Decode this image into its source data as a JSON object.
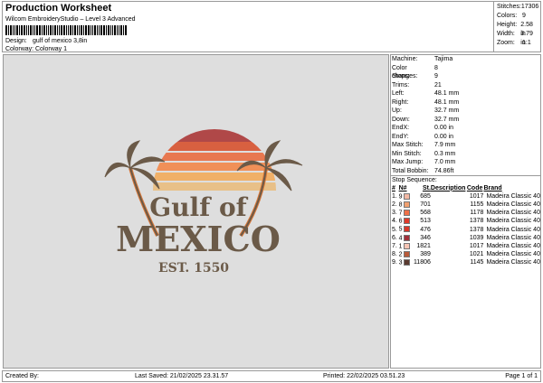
{
  "header": {
    "title": "Production Worksheet",
    "software": "Wilcom EmbroideryStudio – Level 3 Advanced",
    "design_label": "Design:",
    "design": "gulf of mexico 3,8in",
    "colorway_label": "Colorway:",
    "colorway": "Colorway 1"
  },
  "stats": [
    {
      "k": "Stitches:",
      "v": "17306"
    },
    {
      "k": "Colors:",
      "v": "9"
    },
    {
      "k": "Height:",
      "v": "2.58 in"
    },
    {
      "k": "Width:",
      "v": "3.79 in"
    },
    {
      "k": "Zoom:",
      "v": "1:1"
    }
  ],
  "artwork": {
    "line1": "Gulf of",
    "line2": "MEXICO",
    "line3": "EST. 1550"
  },
  "props": [
    {
      "k": "Machine:",
      "v": "Tajima"
    },
    {
      "k": "Color changes:",
      "v": "8"
    },
    {
      "k": "Stops:",
      "v": "9"
    },
    {
      "k": "Trims:",
      "v": "21"
    },
    {
      "k": "Left:",
      "v": "48.1 mm"
    },
    {
      "k": "Right:",
      "v": "48.1 mm"
    },
    {
      "k": "Up:",
      "v": "32.7 mm"
    },
    {
      "k": "Down:",
      "v": "32.7 mm"
    },
    {
      "k": "EndX:",
      "v": "0.00 in"
    },
    {
      "k": "EndY:",
      "v": "0.00 in"
    },
    {
      "k": "Max Stitch:",
      "v": "7.9 mm"
    },
    {
      "k": "Min Stitch:",
      "v": "0.3 mm"
    },
    {
      "k": "Max Jump:",
      "v": "7.0 mm"
    },
    {
      "k": "Total Bobbin:",
      "v": "74.86ft"
    }
  ],
  "sequence": {
    "title": "Stop Sequence:",
    "headers": [
      "#",
      "N#",
      "St.",
      "Description",
      "Code",
      "Brand"
    ],
    "rows": [
      {
        "n": "1.",
        "c": "9",
        "color": "#f2b8a4",
        "st": "685",
        "code": "1017",
        "brand": "Madeira Classic 40"
      },
      {
        "n": "2.",
        "c": "8",
        "color": "#f0a070",
        "st": "701",
        "code": "1155",
        "brand": "Madeira Classic 40"
      },
      {
        "n": "3.",
        "c": "7",
        "color": "#f07048",
        "st": "568",
        "code": "1178",
        "brand": "Madeira Classic 40"
      },
      {
        "n": "4.",
        "c": "6",
        "color": "#e03a2a",
        "st": "513",
        "code": "1378",
        "brand": "Madeira Classic 40"
      },
      {
        "n": "5.",
        "c": "5",
        "color": "#d8382a",
        "st": "476",
        "code": "1378",
        "brand": "Madeira Classic 40"
      },
      {
        "n": "6.",
        "c": "4",
        "color": "#a0303a",
        "st": "346",
        "code": "1039",
        "brand": "Madeira Classic 40"
      },
      {
        "n": "7.",
        "c": "1",
        "color": "#f6c4b4",
        "st": "1821",
        "code": "1017",
        "brand": "Madeira Classic 40"
      },
      {
        "n": "8.",
        "c": "2",
        "color": "#b85a3a",
        "st": "389",
        "code": "1021",
        "brand": "Madeira Classic 40"
      },
      {
        "n": "9.",
        "c": "3",
        "color": "#5a3a30",
        "st": "11806",
        "code": "1145",
        "brand": "Madeira Classic 40"
      }
    ]
  },
  "footer": {
    "created": "Created By:",
    "saved": "Last Saved: 21/02/2025 23.31.57",
    "printed": "Printed: 22/02/2025 03.51.23",
    "page": "Page 1 of 1"
  }
}
